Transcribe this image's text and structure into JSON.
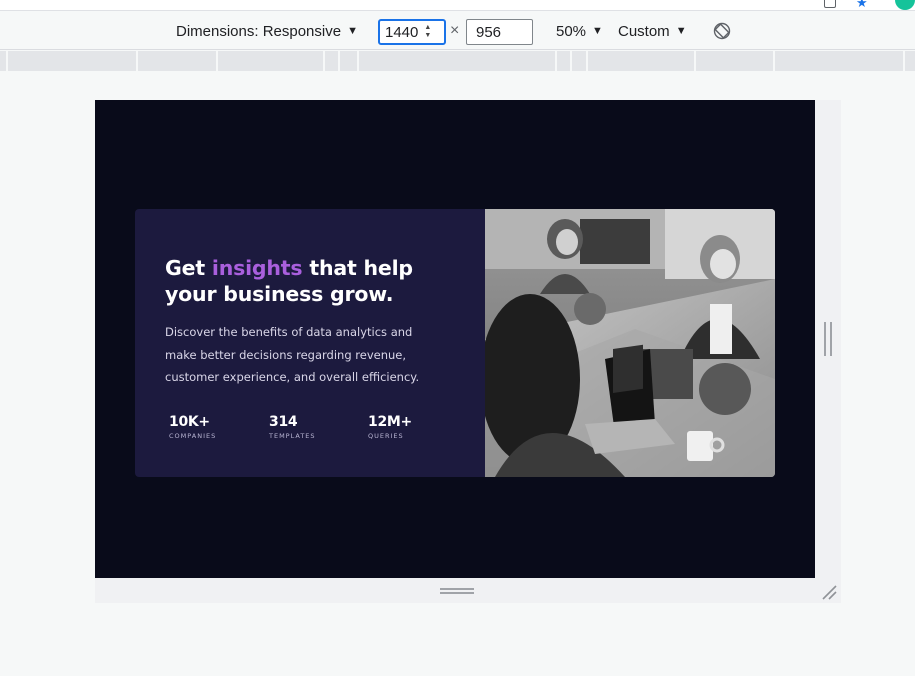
{
  "device_toolbar": {
    "dimensions_label": "Dimensions: Responsive",
    "width_value": "1440",
    "times_symbol": "×",
    "height_value": "956",
    "zoom_label": "50%",
    "throttle_label": "Custom",
    "dropdown_caret": "▼"
  },
  "card": {
    "headline_before": "Get ",
    "headline_accent": "insights",
    "headline_after": " that help your business grow.",
    "description": "Discover the benefits of data analytics and make better decisions regarding revenue, customer experience, and overall efficiency.",
    "stats": [
      {
        "value": "10K+",
        "label": "COMPANIES"
      },
      {
        "value": "314",
        "label": "TEMPLATES"
      },
      {
        "value": "12M+",
        "label": "QUERIES"
      }
    ],
    "accent_color": "#a95fdd",
    "card_color": "#1c1a3e",
    "page_color": "#090b1a"
  },
  "icons": {
    "rotate": "rotate-icon",
    "bookmark": "star-icon",
    "extension": "extension-icon"
  }
}
